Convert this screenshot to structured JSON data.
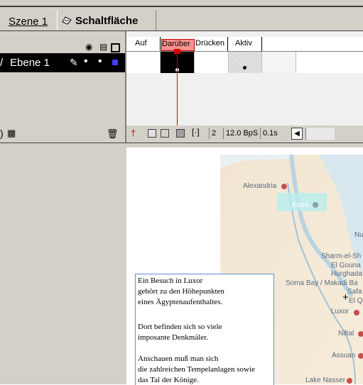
{
  "breadcrumb": {
    "scene": "Szene 1",
    "symbol": "Schaltfläche"
  },
  "timeline": {
    "layer_name": "Ebene 1",
    "frame_labels": [
      "Auf",
      "Darüber",
      "Drücken",
      "Aktiv"
    ],
    "current_frame": "2",
    "fps": "12.0 BpS",
    "elapsed": "0.1s"
  },
  "stage": {
    "text_lines": [
      "Ein Besuch in Luxor",
      "gehört zu den Höhepunkten",
      "eines Ägyptenaufenthaltes.",
      "",
      "Dort befinden sich so viele",
      "imposante Denkmäler.",
      "",
      "Anschauen muß man sich",
      "die zahlreichen Tempelanlagen sowie",
      "das Tal der Könige."
    ],
    "map_labels": {
      "alexandria": "Alexandria",
      "kairo": "Kairo",
      "nu": "Nu",
      "sharm": "Sharm-el-Sh",
      "gouna": "El Gouna",
      "hurghada": "Hurghada",
      "soma": "Soma Bay / Makadi Ba",
      "safa": "Safa",
      "elq": "El Q",
      "luxor": "Luxor",
      "niltal": "Niltal",
      "assuan": "Assuan",
      "nasser": "Lake Nasser"
    }
  },
  "colors": {
    "highlight": "#ff9090",
    "playhead": "#d00000",
    "city_dot": "#cc4c4c",
    "textbox_border": "#5c8fd0"
  }
}
